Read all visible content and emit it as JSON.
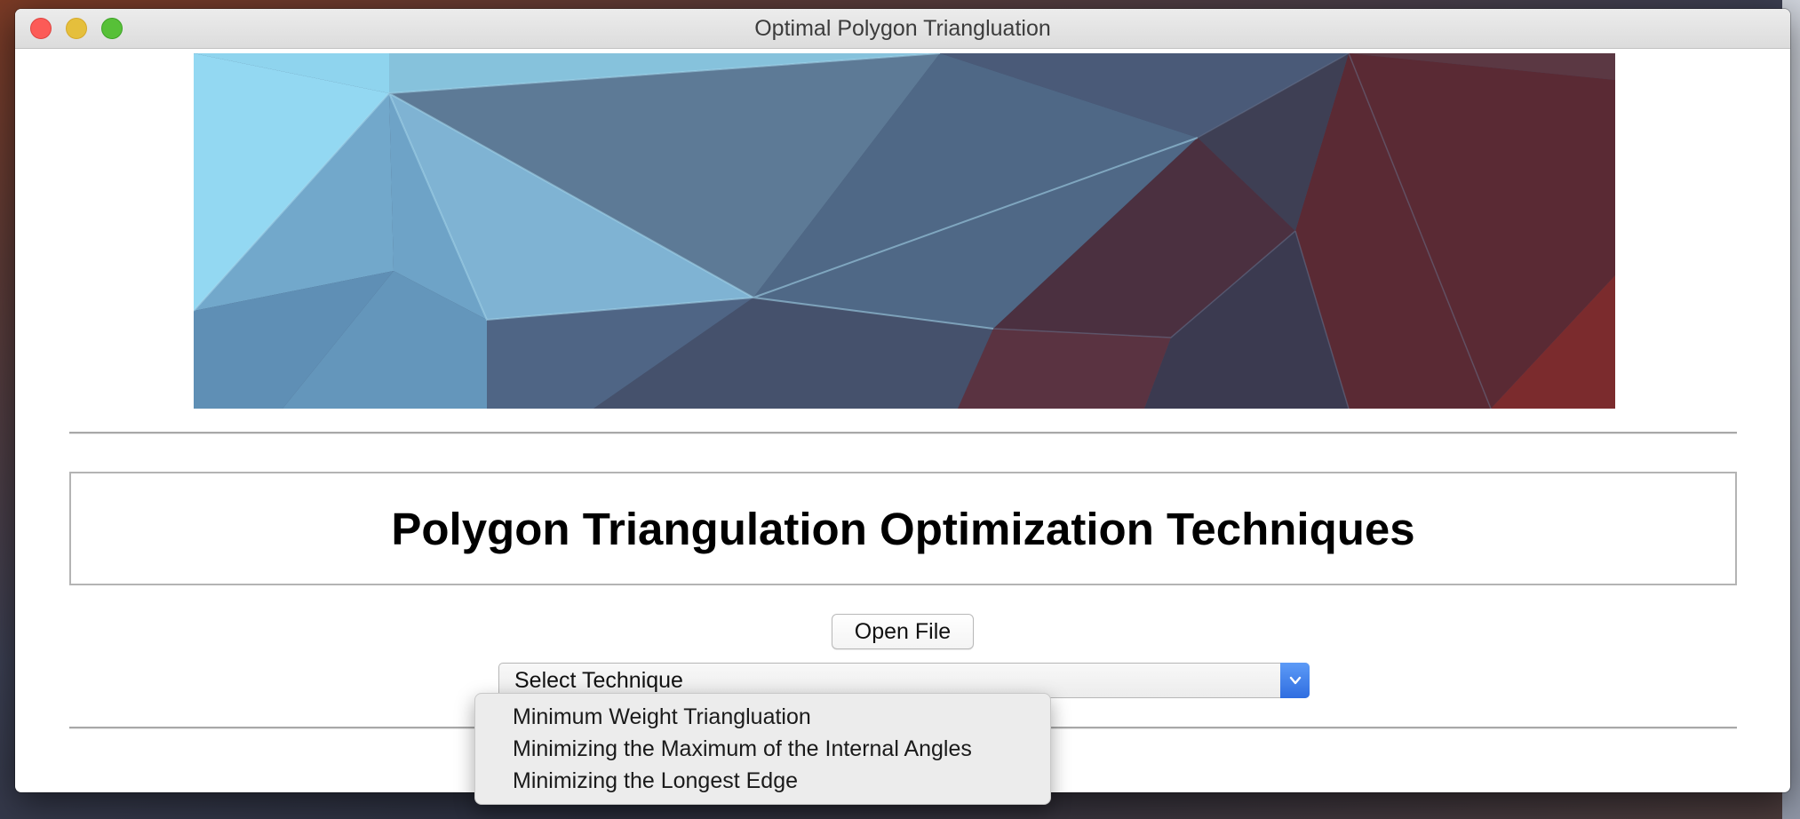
{
  "window": {
    "title": "Optimal Polygon Triangluation"
  },
  "banner": {
    "colors": {
      "light_blue": "#8fd4ee",
      "slate_blue": "#56708c",
      "dark_slate": "#3e475c",
      "maroon": "#5a2a34"
    }
  },
  "main": {
    "heading": "Polygon Triangulation Optimization Techniques",
    "open_file_label": "Open File",
    "technique_select": {
      "selected": "Select Technique",
      "options": [
        "Minimum Weight Triangluation",
        "Minimizing the Maximum of the Internal Angles",
        "Minimizing the Longest Edge"
      ]
    }
  },
  "icons": {
    "dropdown": "chevron-down-icon"
  },
  "colors": {
    "accent": "#3778e8",
    "close": "#fc5b57",
    "minimize": "#e5bf3c",
    "maximize": "#57c038"
  }
}
